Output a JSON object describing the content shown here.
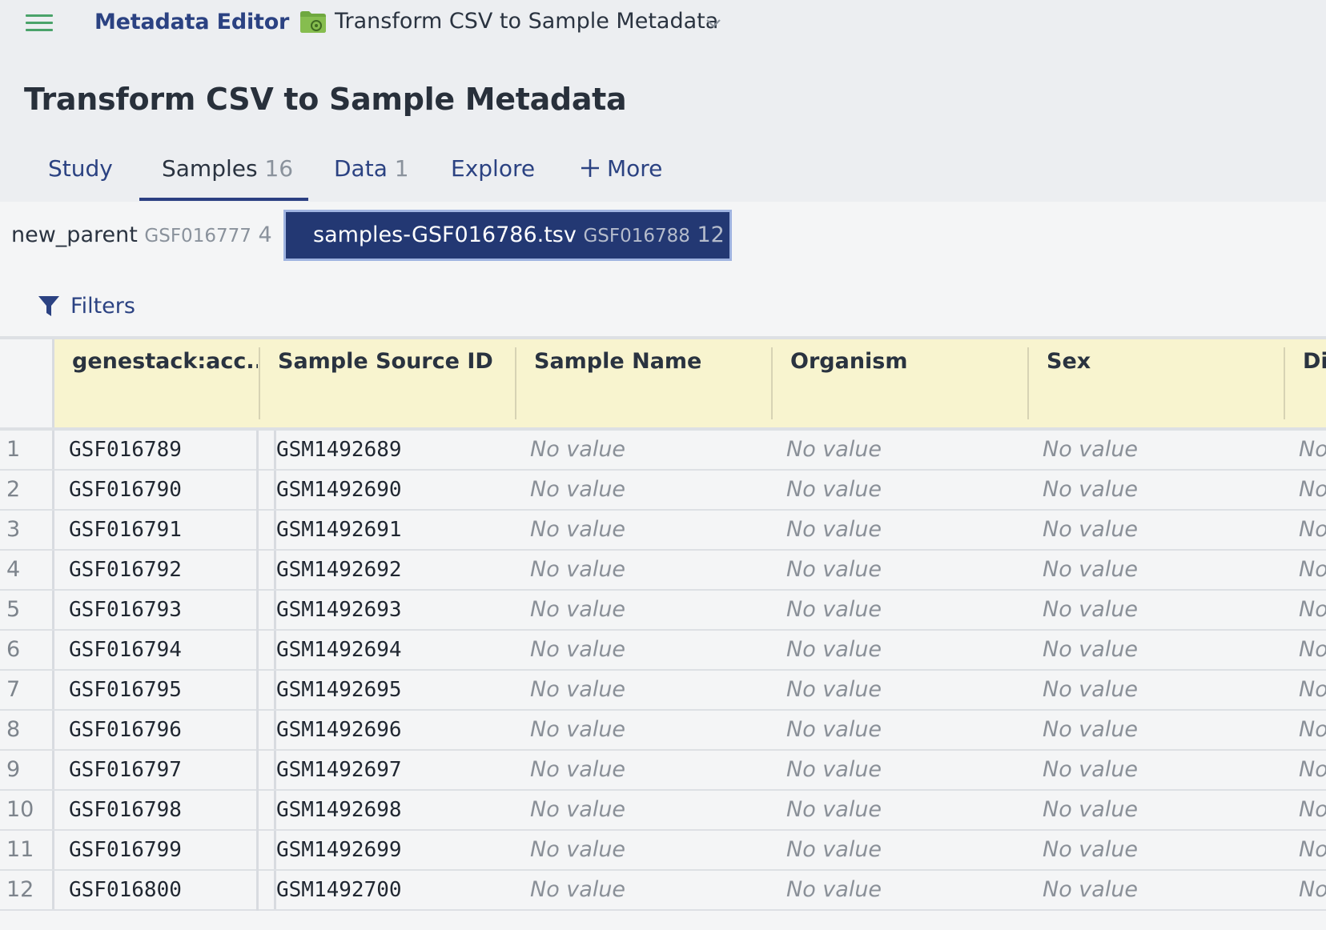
{
  "header": {
    "app_title": "Metadata Editor",
    "breadcrumb_title": "Transform CSV to Sample Metadata"
  },
  "page": {
    "title": "Transform CSV to Sample Metadata"
  },
  "tabs": [
    {
      "label": "Study",
      "count": ""
    },
    {
      "label": "Samples",
      "count": "16"
    },
    {
      "label": "Data",
      "count": "1"
    },
    {
      "label": "Explore",
      "count": ""
    },
    {
      "label": "More",
      "count": ""
    }
  ],
  "active_tab": "Samples",
  "datasets": [
    {
      "name": "new_parent",
      "accession": "GSF016777",
      "count": "4"
    },
    {
      "name": "samples-GSF016786.tsv",
      "accession": "GSF016788",
      "count": "12"
    }
  ],
  "filters_label": "Filters",
  "table": {
    "columns": [
      "genestack:acc...",
      "Sample Source ID",
      "Sample Name",
      "Organism",
      "Sex",
      "Di"
    ],
    "rows": [
      {
        "n": "1",
        "acc": "GSF016789",
        "src": "GSM1492689",
        "name": "No value",
        "org": "No value",
        "sex": "No value",
        "dis": "No"
      },
      {
        "n": "2",
        "acc": "GSF016790",
        "src": "GSM1492690",
        "name": "No value",
        "org": "No value",
        "sex": "No value",
        "dis": "No"
      },
      {
        "n": "3",
        "acc": "GSF016791",
        "src": "GSM1492691",
        "name": "No value",
        "org": "No value",
        "sex": "No value",
        "dis": "No"
      },
      {
        "n": "4",
        "acc": "GSF016792",
        "src": "GSM1492692",
        "name": "No value",
        "org": "No value",
        "sex": "No value",
        "dis": "No"
      },
      {
        "n": "5",
        "acc": "GSF016793",
        "src": "GSM1492693",
        "name": "No value",
        "org": "No value",
        "sex": "No value",
        "dis": "No"
      },
      {
        "n": "6",
        "acc": "GSF016794",
        "src": "GSM1492694",
        "name": "No value",
        "org": "No value",
        "sex": "No value",
        "dis": "No"
      },
      {
        "n": "7",
        "acc": "GSF016795",
        "src": "GSM1492695",
        "name": "No value",
        "org": "No value",
        "sex": "No value",
        "dis": "No"
      },
      {
        "n": "8",
        "acc": "GSF016796",
        "src": "GSM1492696",
        "name": "No value",
        "org": "No value",
        "sex": "No value",
        "dis": "No"
      },
      {
        "n": "9",
        "acc": "GSF016797",
        "src": "GSM1492697",
        "name": "No value",
        "org": "No value",
        "sex": "No value",
        "dis": "No"
      },
      {
        "n": "10",
        "acc": "GSF016798",
        "src": "GSM1492698",
        "name": "No value",
        "org": "No value",
        "sex": "No value",
        "dis": "No"
      },
      {
        "n": "11",
        "acc": "GSF016799",
        "src": "GSM1492699",
        "name": "No value",
        "org": "No value",
        "sex": "No value",
        "dis": "No"
      },
      {
        "n": "12",
        "acc": "GSF016800",
        "src": "GSM1492700",
        "name": "No value",
        "org": "No value",
        "sex": "No value",
        "dis": "No"
      }
    ]
  },
  "icons": {
    "menu": "hamburger-menu-icon",
    "folder": "folder-icon",
    "chevron": "chevron-down-icon",
    "plus": "plus-icon",
    "filter": "filter-funnel-icon"
  },
  "colors": {
    "accent": "#2b4282",
    "active_dataset_bg": "#233873",
    "header_row_bg": "#f8f4cf",
    "menu_icon": "#4aa36a"
  }
}
